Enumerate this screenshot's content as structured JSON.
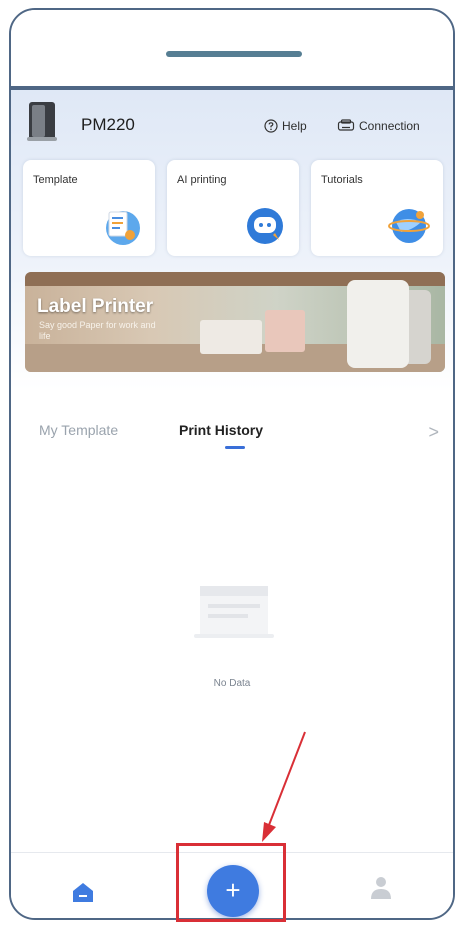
{
  "header": {
    "device_name": "PM220",
    "help_label": "Help",
    "connection_label": "Connection"
  },
  "cards": [
    {
      "label": "Template",
      "icon": "template-icon"
    },
    {
      "label": "AI printing",
      "icon": "chat-icon"
    },
    {
      "label": "Tutorials",
      "icon": "globe-icon"
    }
  ],
  "banner": {
    "title": "Label Printer",
    "subtitle": "Say good Paper for work and life"
  },
  "tabs": {
    "my_template": "My Template",
    "print_history": "Print History",
    "more": ">"
  },
  "empty_state": {
    "message": "No Data"
  },
  "bottom_nav": {
    "fab_symbol": "+",
    "home_icon": "home-icon",
    "profile_icon": "profile-icon"
  },
  "colors": {
    "frame": "#4f6785",
    "accent": "#3f7be0",
    "highlight": "#d92f36"
  }
}
